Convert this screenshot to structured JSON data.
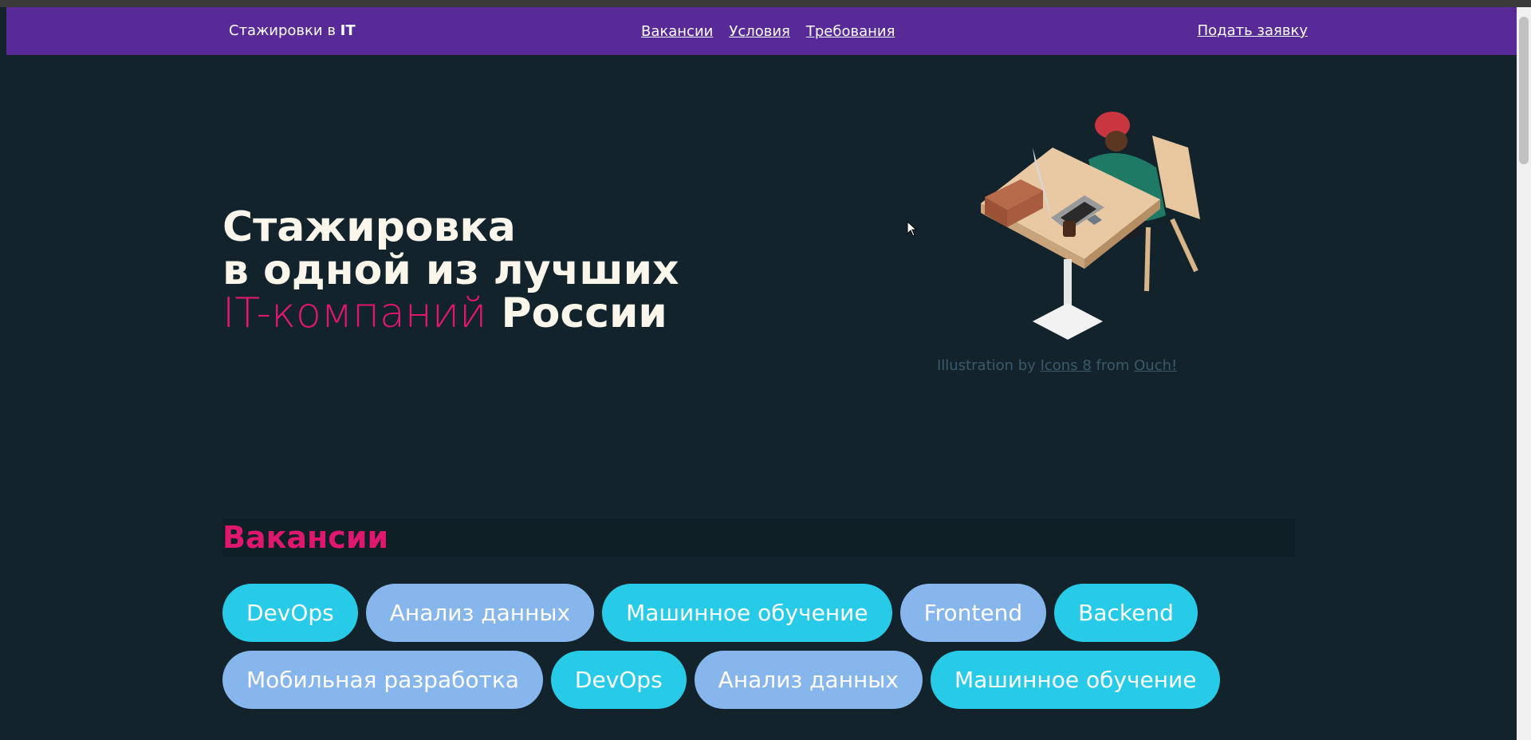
{
  "nav": {
    "brand_prefix": "Стажировки в ",
    "brand_bold": "IT",
    "links": [
      "Вакансии",
      "Условия",
      "Требования"
    ],
    "apply": "Подать заявку"
  },
  "hero": {
    "line1": "Стажировка",
    "line2": "в одной из лучших",
    "line3_accent": "IT-компаний",
    "line3_rest": " России"
  },
  "caption": {
    "prefix": "Illustration by ",
    "link1": "Icons 8",
    "middle": " from ",
    "link2": "Ouch!"
  },
  "vacancies": {
    "title": "Вакансии",
    "chips": [
      {
        "label": "DevOps",
        "color": "#27cbe8"
      },
      {
        "label": "Анализ данных",
        "color": "#87b6ec"
      },
      {
        "label": "Машинное обучение",
        "color": "#27cbe8"
      },
      {
        "label": "Frontend",
        "color": "#87b6ec"
      },
      {
        "label": "Backend",
        "color": "#27cbe8"
      },
      {
        "label": "Мобильная разработка",
        "color": "#87b6ec"
      },
      {
        "label": "DevOps",
        "color": "#27cbe8"
      },
      {
        "label": "Анализ данных",
        "color": "#87b6ec"
      },
      {
        "label": "Машинное обучение",
        "color": "#27cbe8"
      }
    ]
  },
  "colors": {
    "nav_bg": "#572a97",
    "page_bg": "#12232b",
    "accent": "#e0176f"
  }
}
